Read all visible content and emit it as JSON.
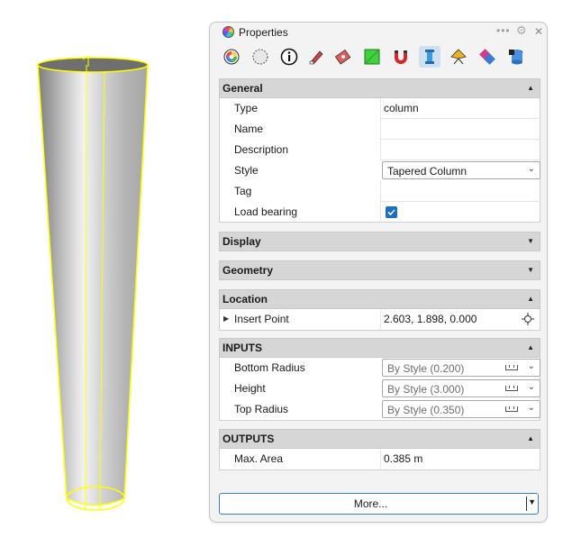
{
  "panel": {
    "title": "Properties",
    "toolbar_icons": [
      "color-wheel-icon",
      "material-icon",
      "info-icon",
      "paint-icon",
      "texture-icon",
      "decal-icon",
      "magnet-icon",
      "column-icon",
      "light-icon",
      "network-icon",
      "database-icon"
    ],
    "active_icon": "column-icon"
  },
  "general": {
    "header": "General",
    "rows": [
      {
        "label": "Type",
        "value": "column"
      },
      {
        "label": "Name",
        "value": ""
      },
      {
        "label": "Description",
        "value": ""
      },
      {
        "label": "Style",
        "value": "Tapered Column"
      },
      {
        "label": "Tag",
        "value": ""
      },
      {
        "label": "Load bearing",
        "value": "true"
      }
    ]
  },
  "display": {
    "header": "Display"
  },
  "geometry": {
    "header": "Geometry"
  },
  "location": {
    "header": "Location",
    "insert_label": "Insert Point",
    "insert_value": "2.603, 1.898, 0.000"
  },
  "inputs": {
    "header": "INPUTS",
    "rows": [
      {
        "label": "Bottom Radius",
        "value": "By Style (0.200)"
      },
      {
        "label": "Height",
        "value": "By Style (3.000)"
      },
      {
        "label": "Top Radius",
        "value": "By Style (0.350)"
      }
    ]
  },
  "outputs": {
    "header": "OUTPUTS",
    "rows": [
      {
        "label": "Max. Area",
        "value": "0.385 m"
      }
    ]
  },
  "more_button": "More...",
  "colors": {
    "highlight": "#ffff00",
    "accent": "#1a6fc7",
    "header": "#d6d6d6"
  }
}
